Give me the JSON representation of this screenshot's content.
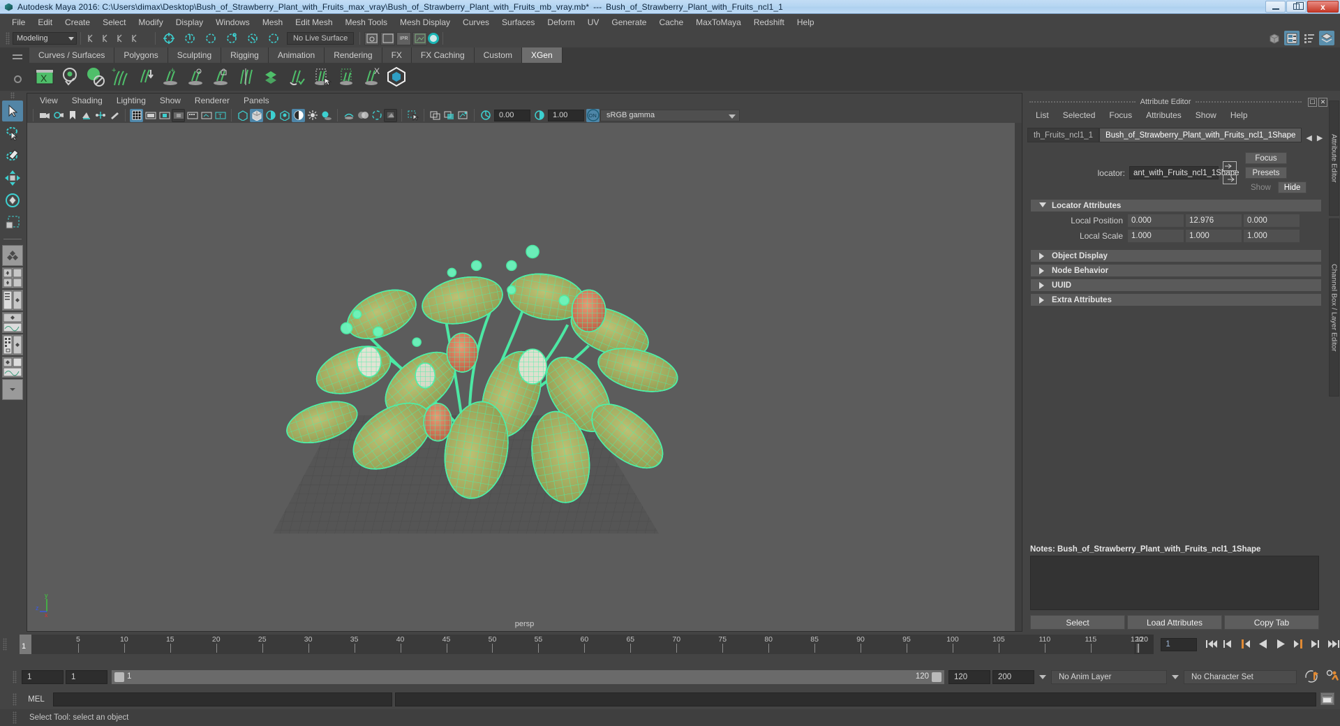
{
  "titlebar": {
    "app_title": "Autodesk Maya 2016: C:\\Users\\dimax\\Desktop\\Bush_of_Strawberry_Plant_with_Fruits_max_vray\\Bush_of_Strawberry_Plant_with_Fruits_mb_vray.mb*",
    "separator": "---",
    "selection_name": "Bush_of_Strawberry_Plant_with_Fruits_ncl1_1",
    "minimize_label": "",
    "restore_label": "",
    "close_label": "x"
  },
  "menubar": {
    "items": [
      "File",
      "Edit",
      "Create",
      "Select",
      "Modify",
      "Display",
      "Windows",
      "Mesh",
      "Edit Mesh",
      "Mesh Tools",
      "Mesh Display",
      "Curves",
      "Surfaces",
      "Deform",
      "UV",
      "Generate",
      "Cache",
      "MaxToMaya",
      "Redshift",
      "Help"
    ]
  },
  "statusline": {
    "mode": "Modeling",
    "live_surface": "No Live Surface",
    "ipr_label": "IPR"
  },
  "shelf": {
    "tabs": [
      "Curves / Surfaces",
      "Polygons",
      "Sculpting",
      "Rigging",
      "Animation",
      "Rendering",
      "FX",
      "FX Caching",
      "Custom",
      "XGen"
    ],
    "active_tab": "XGen",
    "icon_names": [
      "xgen-editor-icon",
      "xgen-preview-icon",
      "xgen-no-sphere-icon",
      "xgen-add-grooming-icon",
      "xgen-import-icon",
      "xgen-add-guide-icon",
      "xgen-guide-region-icon",
      "xgen-lock-guide-icon",
      "xgen-clear-guide-icon",
      "xgen-convert-patch-icon",
      "xgen-sculpt-guide-icon",
      "xgen-select-guide-icon",
      "xgen-rect-select-icon",
      "xgen-delete-guide-icon",
      "xgen-bifrost-icon"
    ]
  },
  "toolbox": {
    "tools": [
      "select-tool",
      "lasso-select-tool",
      "paint-select-tool",
      "move-tool",
      "rotate-tool",
      "scale-tool"
    ],
    "layouts": [
      "single-perspective-layout",
      "four-view-layout",
      "outliner-persp-layout",
      "persp-graph-layout",
      "hypershade-persp-layout",
      "persp-graph-outliner-layout",
      "more-layouts"
    ],
    "selected_tool": "select-tool"
  },
  "viewport": {
    "menu": [
      "View",
      "Shading",
      "Lighting",
      "Show",
      "Renderer",
      "Panels"
    ],
    "exposure_value": "0.00",
    "gamma_value": "1.00",
    "color_management": "sRGB gamma",
    "color_management_toggle": "ON",
    "camera_label": "persp",
    "axis_x": "x",
    "axis_y": "y",
    "axis_z": "z",
    "wireframe_color": "#4cf0a8",
    "leaf_color": "#a8b05c",
    "fruit_color": "#d97a5a",
    "background_color": "#5c5c5c",
    "grid_color": "#4a4a4a"
  },
  "attribute_editor": {
    "panel_title": "Attribute Editor",
    "menu": [
      "List",
      "Selected",
      "Focus",
      "Attributes",
      "Show",
      "Help"
    ],
    "tabs": [
      {
        "label": "th_Fruits_ncl1_1",
        "active": false
      },
      {
        "label": "Bush_of_Strawberry_Plant_with_Fruits_ncl1_1Shape",
        "active": true
      }
    ],
    "locator_label": "locator:",
    "locator_value": "ant_with_Fruits_ncl1_1Shape",
    "focus_button": "Focus",
    "presets_button": "Presets",
    "show_button": "Show",
    "hide_button": "Hide",
    "sections": [
      {
        "title": "Locator Attributes",
        "expanded": true
      },
      {
        "title": "Object Display",
        "expanded": false
      },
      {
        "title": "Node Behavior",
        "expanded": false
      },
      {
        "title": "UUID",
        "expanded": false
      },
      {
        "title": "Extra Attributes",
        "expanded": false
      }
    ],
    "attributes": [
      {
        "label": "Local Position",
        "values": [
          "0.000",
          "12.976",
          "0.000"
        ]
      },
      {
        "label": "Local Scale",
        "values": [
          "1.000",
          "1.000",
          "1.000"
        ]
      }
    ],
    "notes_label": "Notes:",
    "notes_value": "Bush_of_Strawberry_Plant_with_Fruits_ncl1_1Shape",
    "notes_content": "",
    "footer_buttons": [
      "Select",
      "Load Attributes",
      "Copy Tab"
    ],
    "side_tabs": [
      "Attribute Editor",
      "Channel Box / Layer Editor"
    ]
  },
  "timeline": {
    "current_frame": "1",
    "end_marker": "120",
    "frame_input": "1",
    "ticks": [
      5,
      10,
      15,
      20,
      25,
      30,
      35,
      40,
      45,
      50,
      55,
      60,
      65,
      70,
      75,
      80,
      85,
      90,
      95,
      100,
      105,
      110,
      115,
      120
    ],
    "playback_icons": [
      "go-to-start",
      "step-back-key",
      "step-back-frame",
      "play-backwards",
      "play-forwards",
      "step-forward-frame",
      "step-forward-key",
      "go-to-end"
    ]
  },
  "range_slider": {
    "anim_start": "1",
    "range_start": "1",
    "slider_left_value": "1",
    "slider_right_value": "120",
    "range_end": "120",
    "anim_end": "200",
    "anim_layer": "No Anim Layer",
    "character_set": "No Character Set"
  },
  "command_line": {
    "language_label": "MEL",
    "input_value": "",
    "output_value": ""
  },
  "status_bar": {
    "help_text": "Select Tool: select an object"
  }
}
